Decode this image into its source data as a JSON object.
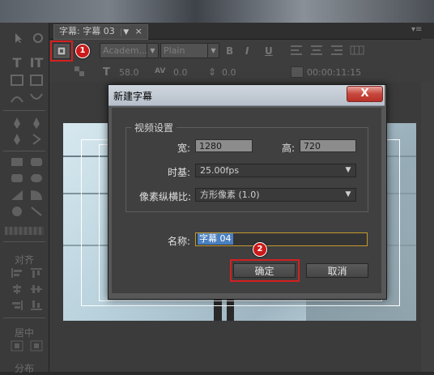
{
  "tab": {
    "title": "字幕: 字幕 03",
    "menu_glyph": "▼",
    "close_glyph": "×",
    "panel_menu_glyph": "▾≡"
  },
  "toolbox": {
    "align_label": "对齐",
    "center_label": "居中",
    "distribute_label": "分布"
  },
  "toolbar": {
    "font_family": "Academ...",
    "font_style": "Plain",
    "font_size": "58.0",
    "kerning": "0.0",
    "leading": "0.0",
    "timecode": "00:00:11:15",
    "bold_label": "B",
    "italic_label": "I",
    "underline_label": "U"
  },
  "dialog": {
    "title": "新建字幕",
    "close_label": "X",
    "video_settings_group": "视频设置",
    "width_label": "宽:",
    "width_value": "1280",
    "height_label": "高:",
    "height_value": "720",
    "timebase_label": "时基:",
    "timebase_value": "25.00fps",
    "pixel_aspect_label": "像素纵横比:",
    "pixel_aspect_value": "方形像素 (1.0)",
    "name_label": "名称:",
    "name_value": "字幕 04",
    "ok_label": "确定",
    "cancel_label": "取消"
  },
  "callouts": {
    "first": "1",
    "second": "2"
  },
  "colors": {
    "highlight_frame": "#d42020",
    "callout_bg": "#cc1a1a",
    "selection": "#4a7fc0",
    "focus_border": "#c69a2c"
  }
}
